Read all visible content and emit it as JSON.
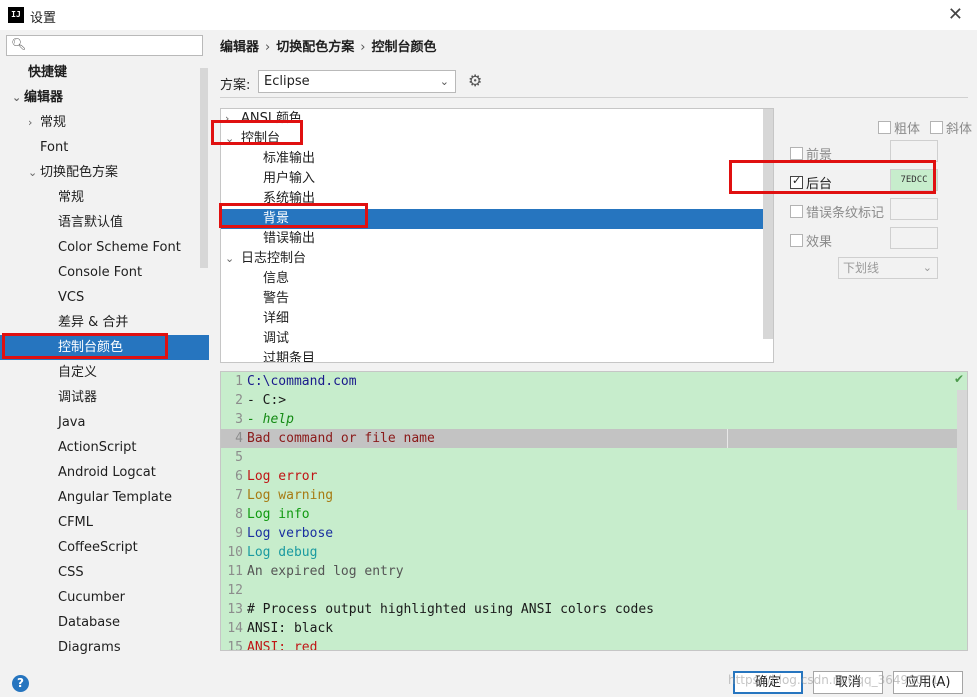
{
  "window": {
    "title": "设置",
    "app_icon": "IJ"
  },
  "sidebar": {
    "search_placeholder": "",
    "items": [
      {
        "label": "快捷键",
        "level": 0,
        "arrow": "",
        "bold": true
      },
      {
        "label": "编辑器",
        "level": 0,
        "arrow": "⌄",
        "bold": true
      },
      {
        "label": "常规",
        "level": 1,
        "arrow": "›"
      },
      {
        "label": "Font",
        "level": 1,
        "arrow": ""
      },
      {
        "label": "切换配色方案",
        "level": 1,
        "arrow": "⌄"
      },
      {
        "label": "常规",
        "level": 2,
        "arrow": ""
      },
      {
        "label": "语言默认值",
        "level": 2,
        "arrow": ""
      },
      {
        "label": "Color Scheme Font",
        "level": 2,
        "arrow": ""
      },
      {
        "label": "Console Font",
        "level": 2,
        "arrow": ""
      },
      {
        "label": "VCS",
        "level": 2,
        "arrow": ""
      },
      {
        "label": "差异 & 合并",
        "level": 2,
        "arrow": ""
      },
      {
        "label": "控制台颜色",
        "level": 2,
        "arrow": "",
        "selected": true
      },
      {
        "label": "自定义",
        "level": 2,
        "arrow": ""
      },
      {
        "label": "调试器",
        "level": 2,
        "arrow": ""
      },
      {
        "label": "Java",
        "level": 2,
        "arrow": ""
      },
      {
        "label": "ActionScript",
        "level": 2,
        "arrow": ""
      },
      {
        "label": "Android Logcat",
        "level": 2,
        "arrow": ""
      },
      {
        "label": "Angular Template",
        "level": 2,
        "arrow": ""
      },
      {
        "label": "CFML",
        "level": 2,
        "arrow": ""
      },
      {
        "label": "CoffeeScript",
        "level": 2,
        "arrow": ""
      },
      {
        "label": "CSS",
        "level": 2,
        "arrow": ""
      },
      {
        "label": "Cucumber",
        "level": 2,
        "arrow": ""
      },
      {
        "label": "Database",
        "level": 2,
        "arrow": ""
      },
      {
        "label": "Diagrams",
        "level": 2,
        "arrow": ""
      }
    ]
  },
  "breadcrumb": [
    "编辑器",
    "切换配色方案",
    "控制台颜色"
  ],
  "scheme": {
    "label": "方案:",
    "value": "Eclipse"
  },
  "attribute_tree": [
    {
      "label": "ANSI 颜色",
      "level": 0,
      "arrow": "›"
    },
    {
      "label": "控制台",
      "level": 0,
      "arrow": "⌄"
    },
    {
      "label": "标准输出",
      "level": 1,
      "arrow": ""
    },
    {
      "label": "用户输入",
      "level": 1,
      "arrow": ""
    },
    {
      "label": "系统输出",
      "level": 1,
      "arrow": ""
    },
    {
      "label": "背景",
      "level": 1,
      "arrow": "",
      "selected": true
    },
    {
      "label": "错误输出",
      "level": 1,
      "arrow": ""
    },
    {
      "label": "日志控制台",
      "level": 0,
      "arrow": "⌄"
    },
    {
      "label": "信息",
      "level": 1,
      "arrow": ""
    },
    {
      "label": "警告",
      "level": 1,
      "arrow": ""
    },
    {
      "label": "详细",
      "level": 1,
      "arrow": ""
    },
    {
      "label": "调试",
      "level": 1,
      "arrow": ""
    },
    {
      "label": "过期条目",
      "level": 1,
      "arrow": ""
    }
  ],
  "properties": {
    "bold": "粗体",
    "italic": "斜体",
    "foreground": "前景",
    "background": "后台",
    "background_checked": true,
    "background_color": "7EDCC",
    "error_stripe": "错误条纹标记",
    "effects": "效果",
    "effect_type": "下划线"
  },
  "preview": {
    "lines": [
      {
        "n": "1",
        "text": "C:\\command.com",
        "color": "#1a1a8c",
        "italic": false
      },
      {
        "n": "2",
        "text": "- C:>",
        "color": "#1a1a1a",
        "italic": false
      },
      {
        "n": "3",
        "text": "- help",
        "color": "#138a13",
        "italic": true
      },
      {
        "n": "4",
        "text": "Bad command or file name",
        "color": "#8b1a1a",
        "italic": false,
        "highlight": true
      },
      {
        "n": "5",
        "text": "",
        "color": "#1a1a1a",
        "italic": false
      },
      {
        "n": "6",
        "text": "Log error",
        "color": "#c01515",
        "italic": false
      },
      {
        "n": "7",
        "text": "Log warning",
        "color": "#a77a12",
        "italic": false
      },
      {
        "n": "8",
        "text": "Log info",
        "color": "#119a11",
        "italic": false
      },
      {
        "n": "9",
        "text": "Log verbose",
        "color": "#1a2fa0",
        "italic": false
      },
      {
        "n": "10",
        "text": "Log debug",
        "color": "#1a9aa0",
        "italic": false
      },
      {
        "n": "11",
        "text": "An expired log entry",
        "color": "#555555",
        "italic": false
      },
      {
        "n": "12",
        "text": "",
        "color": "#1a1a1a",
        "italic": false
      },
      {
        "n": "13",
        "text": "# Process output highlighted using ANSI colors codes",
        "color": "#1a1a1a",
        "italic": false
      },
      {
        "n": "14",
        "text": "ANSI: black",
        "color": "#1a1a1a",
        "italic": false
      },
      {
        "n": "15",
        "text": "ANSI: red",
        "color": "#c01515",
        "italic": false
      }
    ]
  },
  "footer": {
    "ok": "确定",
    "cancel": "取消",
    "apply": "应用(A)",
    "watermark": "https://blog.csdn.net/qq_36490031"
  },
  "colors": {
    "accent": "#2675bf",
    "preview_bg": "#c7edcc",
    "highlight": "#e01010"
  }
}
